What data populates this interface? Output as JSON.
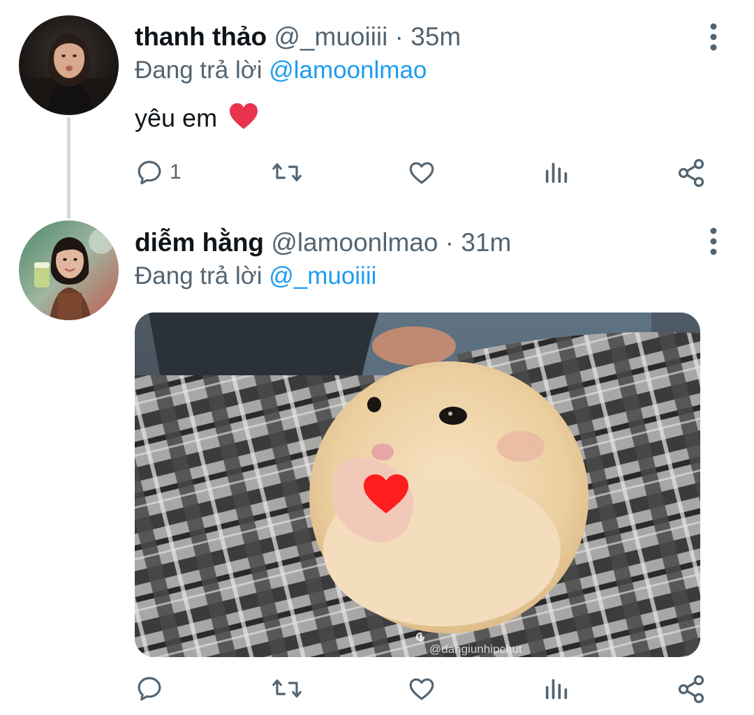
{
  "tweets": [
    {
      "display_name": "thanh thảo",
      "handle": "@_muoiiii",
      "separator": "·",
      "time": "35m",
      "replying_label": "Đang trả lời",
      "replying_to": "@lamoonlmao",
      "text": "yêu em",
      "emoji": "❤️",
      "actions": {
        "replies": "1"
      }
    },
    {
      "display_name": "diễm hằng",
      "handle": "@lamoonlmao",
      "separator": "·",
      "time": "31m",
      "replying_label": "Đang trả lời",
      "replying_to": "@_muoiiii",
      "media": {
        "watermark": "@dangiunhipchut",
        "watermark_icon": "tiktok-icon",
        "overlay_emoji": "❤️"
      }
    }
  ],
  "icons": [
    "more-vertical-icon",
    "reply-icon",
    "retweet-icon",
    "like-icon",
    "views-icon",
    "share-icon"
  ],
  "colors": {
    "accent": "#1d9bf0",
    "secondary_text": "#536471",
    "thread_line": "#cfd9de"
  }
}
